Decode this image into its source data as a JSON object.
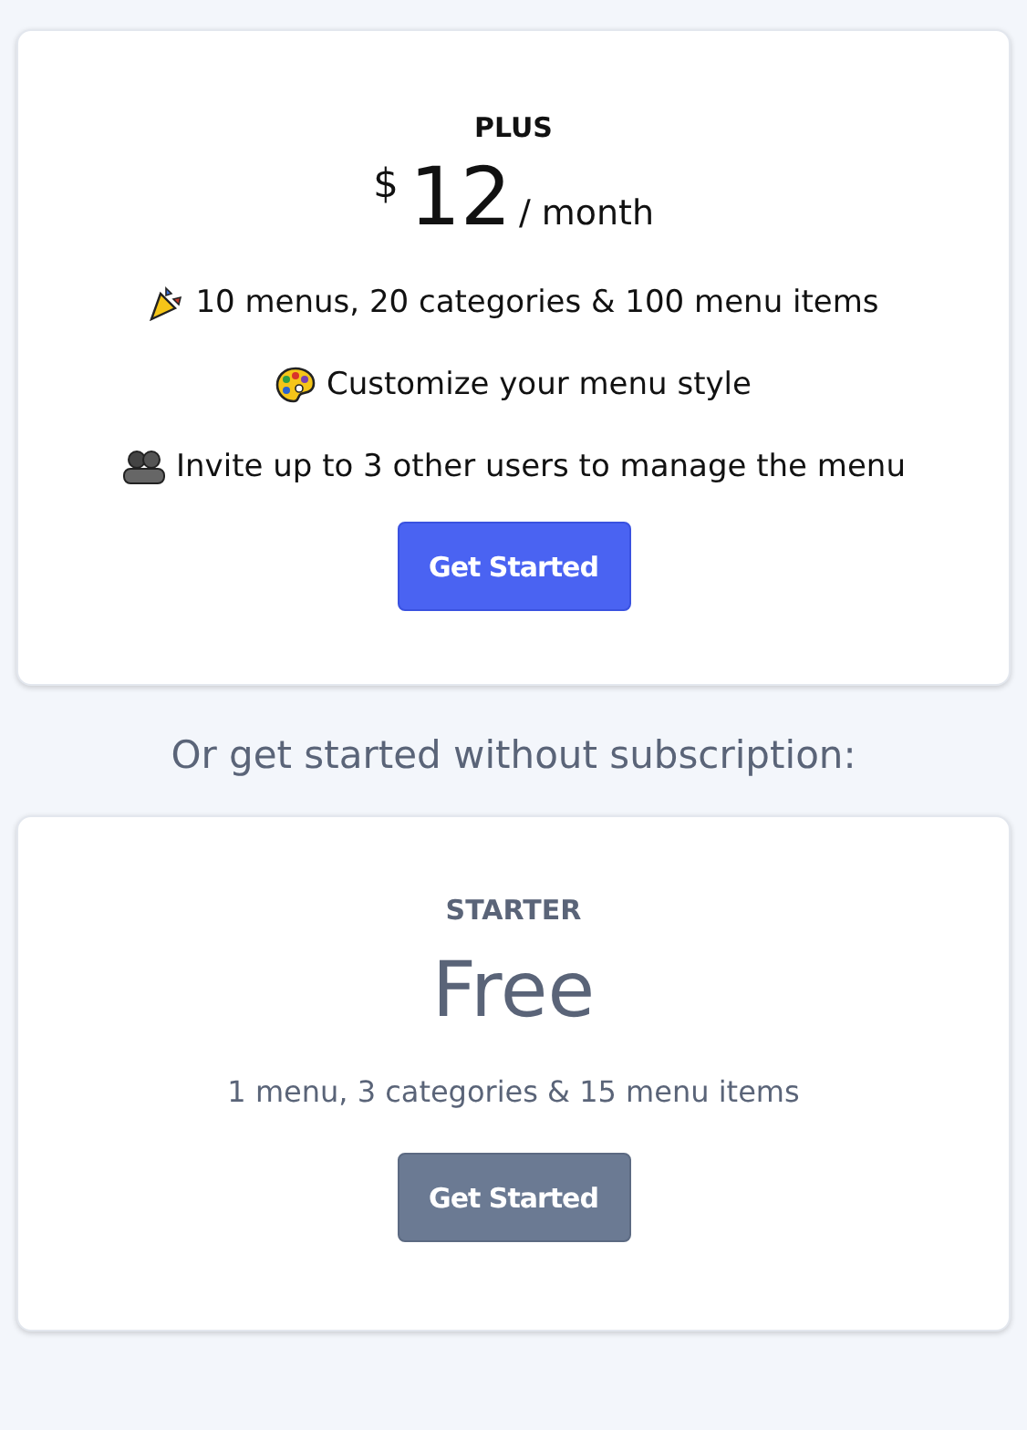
{
  "plans": [
    {
      "kind": "paid",
      "name": "PLUS",
      "currency": "$",
      "price": "12",
      "period": "/ month",
      "features": [
        "10 menus, 20 categories & 100 menu items",
        "Customize your menu style",
        "Invite up to 3 other users to manage the menu"
      ],
      "button": "Get Started"
    },
    {
      "kind": "free",
      "name": "STARTER",
      "price": "Free",
      "features": [
        "1 menu, 3 categories & 15 menu items"
      ],
      "button": "Get Started"
    }
  ],
  "divider_text": "Or get started without subscription:"
}
